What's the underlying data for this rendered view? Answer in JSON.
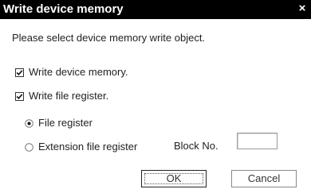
{
  "window": {
    "title": "Write device memory",
    "close_glyph": "×"
  },
  "dialog": {
    "prompt": "Please select device memory write object.",
    "checkboxes": [
      {
        "label": "Write device memory.",
        "checked": true
      },
      {
        "label": "Write file register.",
        "checked": true
      }
    ],
    "radios": [
      {
        "label": "File register",
        "selected": true
      },
      {
        "label": "Extension file register",
        "selected": false
      }
    ],
    "block_no": {
      "label": "Block No.",
      "value": ""
    },
    "buttons": {
      "ok": "OK",
      "cancel": "Cancel"
    }
  }
}
